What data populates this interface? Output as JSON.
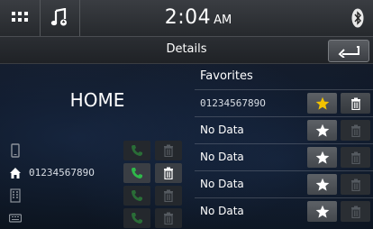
{
  "status_bar": {
    "time": "2:04",
    "ampm": "AM",
    "icons": [
      "grid-icon",
      "music-note-icon",
      "bluetooth-icon"
    ]
  },
  "title_bar": {
    "title": "Details",
    "back_icon": "return-arrow-icon"
  },
  "contact": {
    "name": "HOME",
    "numbers": [
      {
        "type_icon": "mobile-phone-icon",
        "number": "",
        "active": false
      },
      {
        "type_icon": "home-icon",
        "number": "0123456789O",
        "active": true
      },
      {
        "type_icon": "office-building-icon",
        "number": "",
        "active": false
      },
      {
        "type_icon": "other-phone-icon",
        "number": "",
        "active": false
      }
    ]
  },
  "favorites": {
    "title": "Favorites",
    "items": [
      {
        "label": "0123456789O",
        "starred": true,
        "deletable": true
      },
      {
        "label": "No Data",
        "starred": false,
        "deletable": false
      },
      {
        "label": "No Data",
        "starred": false,
        "deletable": false
      },
      {
        "label": "No Data",
        "starred": false,
        "deletable": false
      },
      {
        "label": "No Data",
        "starred": false,
        "deletable": false
      }
    ]
  },
  "colors": {
    "star_active": "#f2c200",
    "call_green": "#2fb84a",
    "accent_bar": "#2b2e33"
  }
}
